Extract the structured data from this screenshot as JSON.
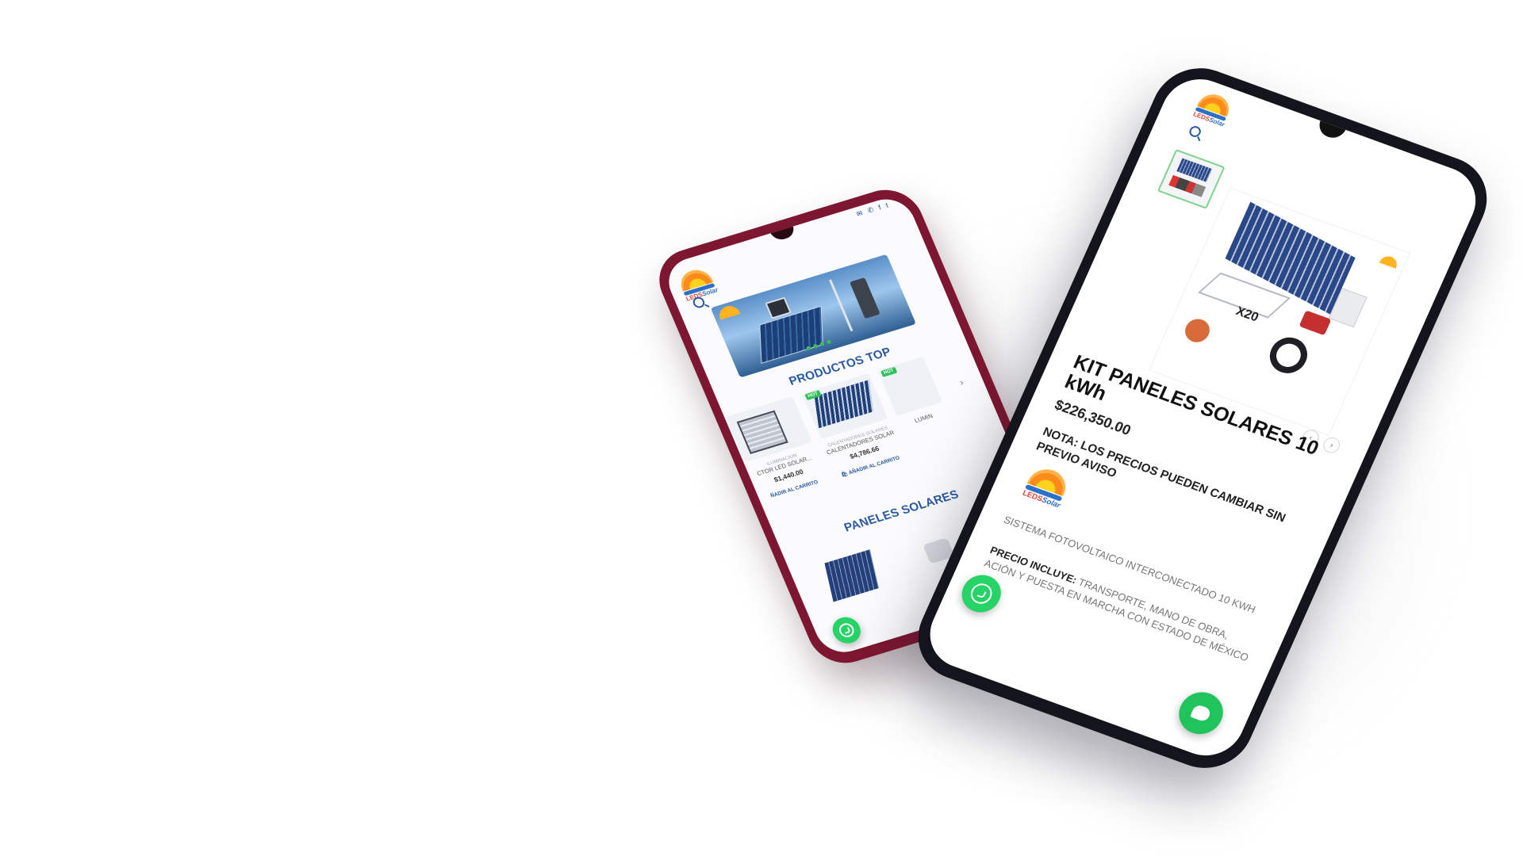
{
  "phone_left": {
    "topbar_icons": [
      "mail-icon",
      "phone-icon",
      "facebook-icon",
      "twitter-icon"
    ],
    "logo_text": "LEDS",
    "logo_text_accent": "Solar",
    "section_top_title": "PRODUCTOS TOP",
    "products": [
      {
        "category": "ILUMINACION",
        "name": "CTOR LED SOLAR...",
        "price": "$1,440.00",
        "cart": "ÑADIR AL CARRITO",
        "badge": ""
      },
      {
        "category": "CALENTADORES SOLARES",
        "name": "CALENTADORES SOLAR...",
        "price": "$4,786.66",
        "cart": "AÑADIR AL CARRITO",
        "badge": "HOT"
      },
      {
        "category": "",
        "name": "LUMIN",
        "price": "",
        "cart": "",
        "badge": "HOT"
      }
    ],
    "section_panels_title": "PANELES SOLARES"
  },
  "phone_right": {
    "logo_text": "LEDS",
    "logo_text_accent": "Solar",
    "product_title": "KIT PANELES SOLARES 10 kWh",
    "price": "$226,350.00",
    "note": "NOTA: LOS PRECIOS PUEDEN CAMBIAR SIN PREVIO AVISO",
    "image_label": "X20",
    "description": "SISTEMA FOTOVOLTAICO INTERCONECTADO 10 kWh",
    "includes_label": "PRECIO INCLUYE:",
    "includes_text": "TRANSPORTE, MANO DE OBRA, ACIÓN Y PUESTA EN MARCHA CON ESTADO DE MÉXICO",
    "nav_prev": "‹",
    "nav_next": "›"
  },
  "colors": {
    "phone_left_frame": "#7d1630",
    "phone_right_frame": "#14141c",
    "heading_blue": "#2b5aa0",
    "whatsapp_green": "#25d366",
    "hot_badge": "#2fbf5b"
  }
}
